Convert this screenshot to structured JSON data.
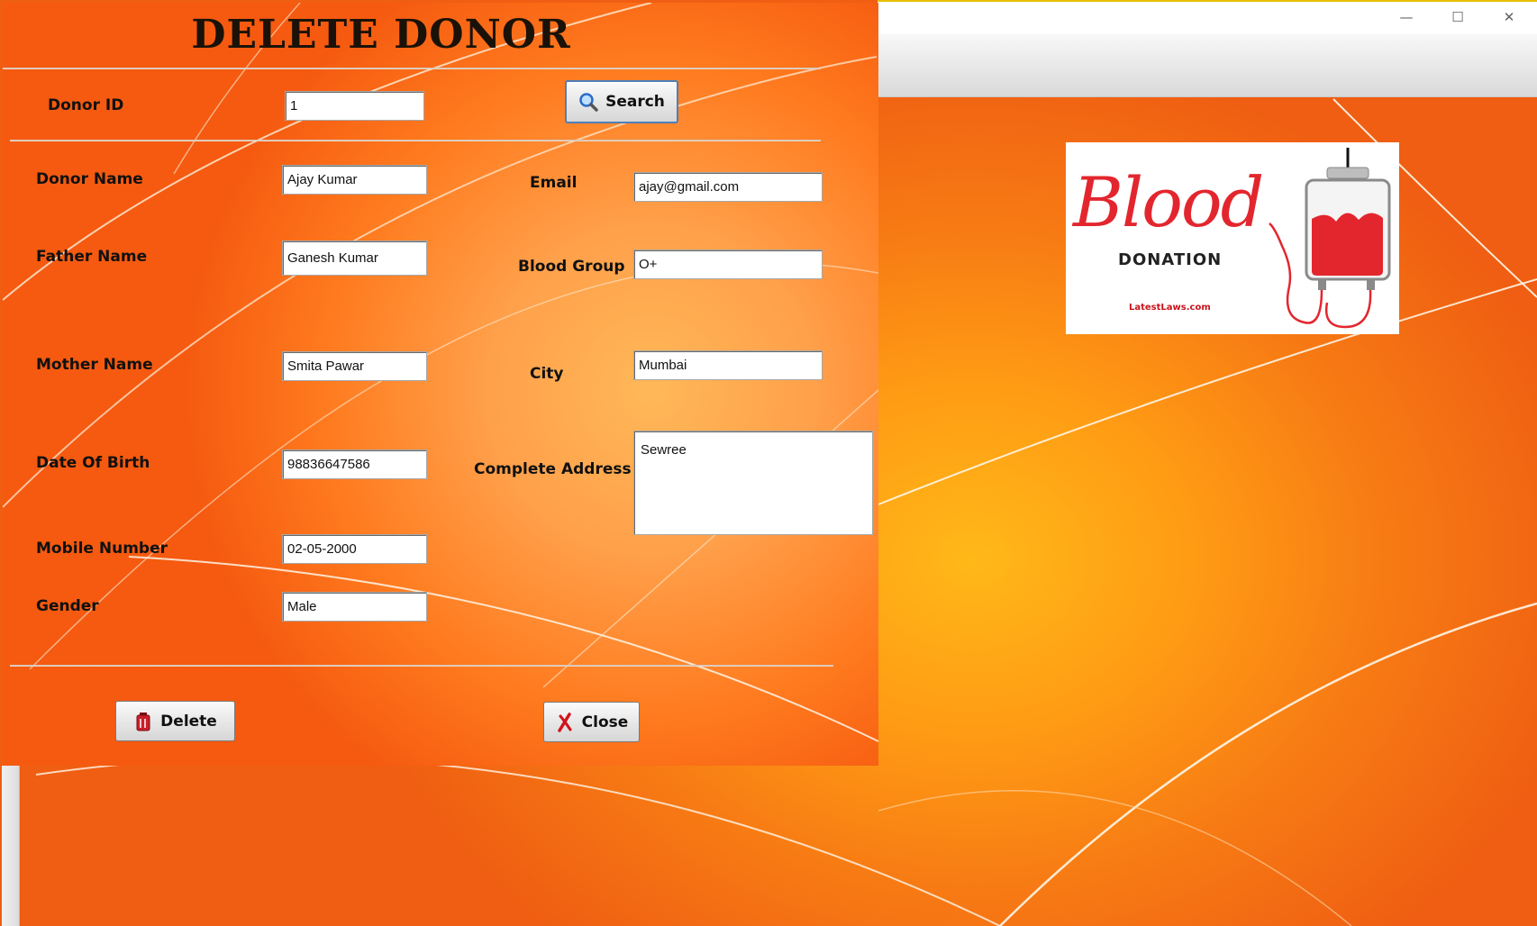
{
  "dialog": {
    "title": "DELETE DONOR",
    "donor_id_label": "Donor ID",
    "donor_id_value": "1",
    "search_label": "Search",
    "delete_label": "Delete",
    "close_label": "Close",
    "fields": {
      "donor_name": {
        "label": "Donor Name",
        "value": "Ajay Kumar"
      },
      "father_name": {
        "label": "Father Name",
        "value": "Ganesh Kumar"
      },
      "mother_name": {
        "label": "Mother Name",
        "value": "Smita Pawar"
      },
      "dob": {
        "label": "Date Of Birth",
        "value": "98836647586"
      },
      "mobile": {
        "label": "Mobile Number",
        "value": "02-05-2000"
      },
      "gender": {
        "label": "Gender",
        "value": "Male"
      },
      "email": {
        "label": "Email",
        "value": "ajay@gmail.com"
      },
      "blood_group": {
        "label": "Blood Group",
        "value": "O+"
      },
      "city": {
        "label": "City",
        "value": "Mumbai"
      },
      "address": {
        "label": "Complete Address",
        "value": "Sewree"
      }
    }
  },
  "logo": {
    "script_text": "Blood",
    "caption": "DONATION",
    "site": "LatestLaws.com"
  },
  "window": {
    "min_glyph": "—",
    "max_glyph": "☐",
    "close_glyph": "✕"
  },
  "colors": {
    "accent_orange": "#f77b14",
    "blood_red": "#e3262e"
  },
  "icons": {
    "search": "magnifier-icon",
    "delete": "trash-icon",
    "close": "red-x-icon"
  }
}
